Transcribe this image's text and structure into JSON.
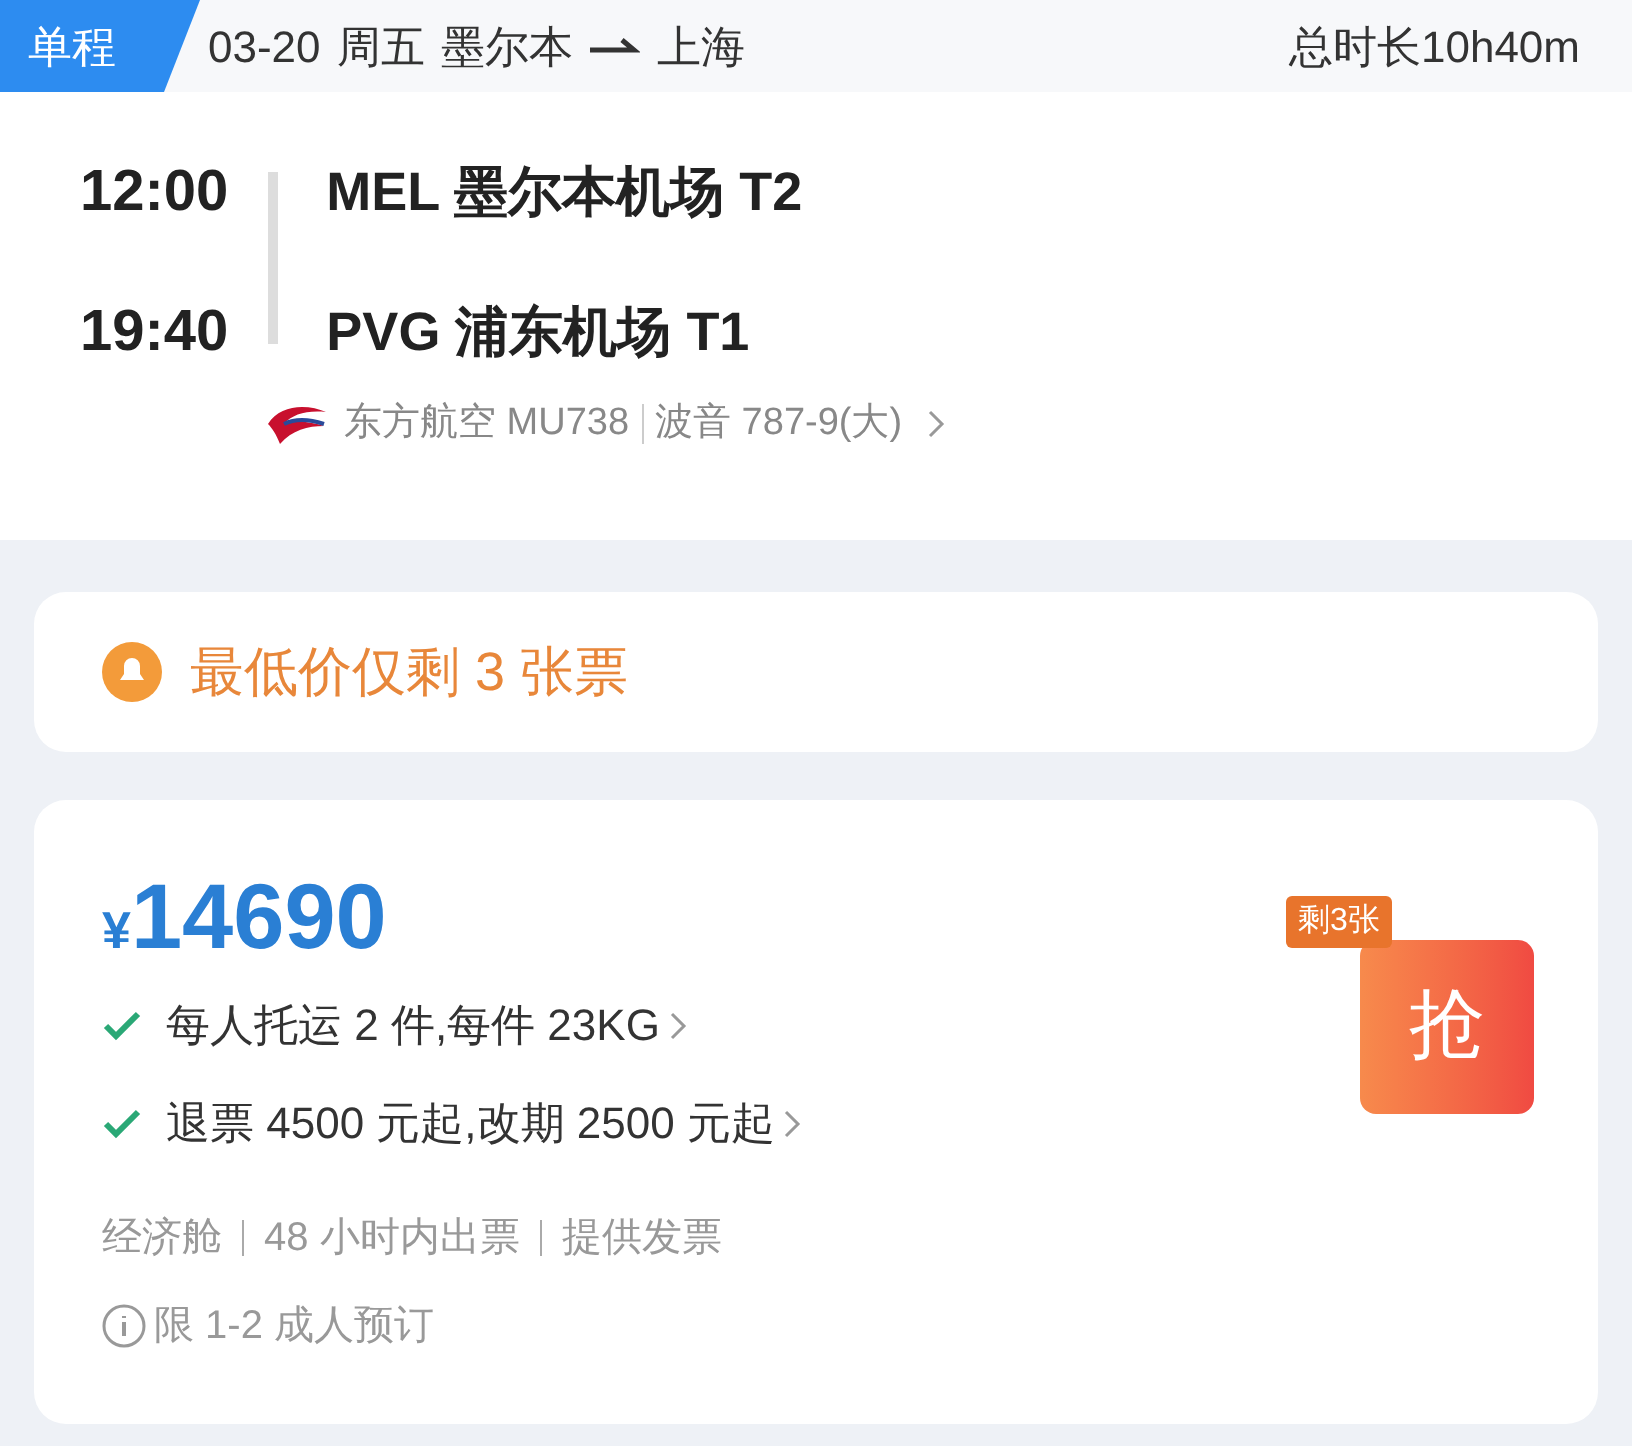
{
  "header": {
    "trip_type": "单程",
    "date": "03-20",
    "weekday": "周五",
    "from": "墨尔本",
    "to": "上海",
    "duration": "总时长10h40m"
  },
  "flight": {
    "segments": [
      {
        "time": "12:00",
        "airport": "MEL 墨尔本机场 T2"
      },
      {
        "time": "19:40",
        "airport": "PVG 浦东机场 T1"
      }
    ],
    "airline": "东方航空 MU738",
    "aircraft": "波音 787-9(大)"
  },
  "notice": {
    "text": "最低价仅剩 3 张票"
  },
  "offer": {
    "currency": "¥",
    "price": "14690",
    "badge": "剩3张",
    "button": "抢",
    "perks": [
      {
        "text": "每人托运 2 件,每件 23KG"
      },
      {
        "text": "退票 4500 元起,改期 2500 元起"
      }
    ],
    "tags": [
      "经济舱",
      "48 小时内出票",
      "提供发票"
    ],
    "limit": "限 1-2 成人预订"
  }
}
